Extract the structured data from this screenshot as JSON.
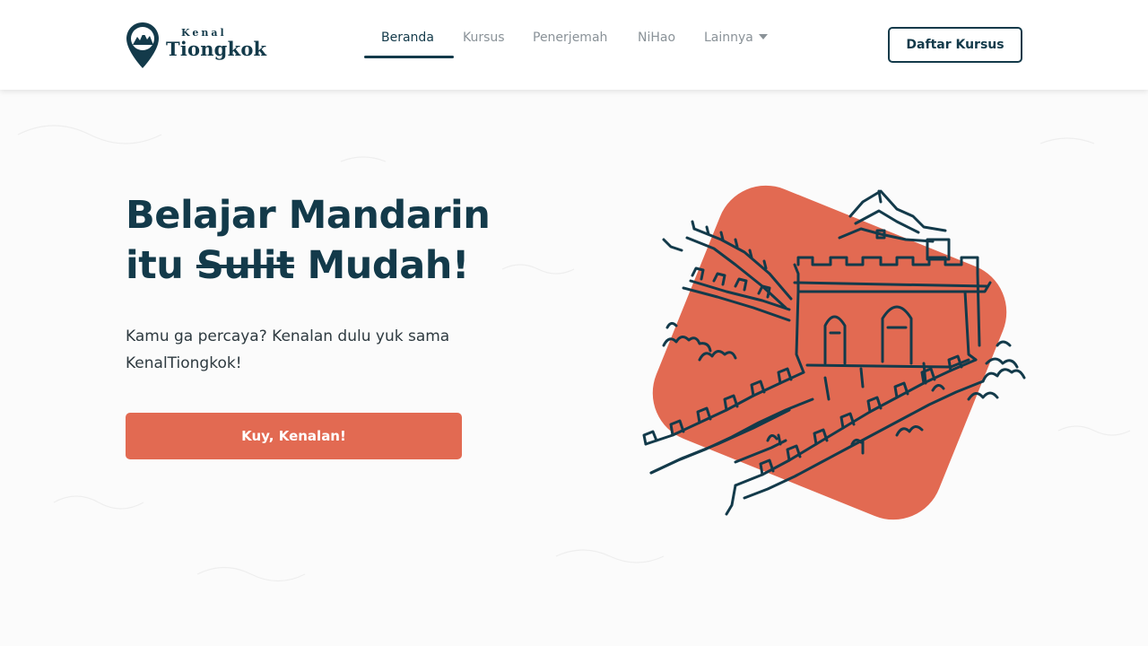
{
  "brand": {
    "small": "Kenal",
    "big": "Tiongkok",
    "colors": {
      "navy": "#133a4a",
      "coral": "#e26a52",
      "muted": "#8a9298"
    }
  },
  "nav": {
    "items": [
      {
        "label": "Beranda",
        "active": true
      },
      {
        "label": "Kursus",
        "active": false
      },
      {
        "label": "Penerjemah",
        "active": false
      },
      {
        "label": "NiHao",
        "active": false
      },
      {
        "label": "Lainnya",
        "active": false,
        "dropdown": true
      }
    ],
    "cta_label": "Daftar Kursus"
  },
  "hero": {
    "title_line1": "Belajar Mandarin",
    "title_itu": "itu",
    "title_struck": "Sulit",
    "title_end": "Mudah!",
    "subtitle": "Kamu ga percaya? Kenalan dulu yuk sama KenalTiongkok!",
    "cta_label": "Kuy, Kenalan!"
  },
  "icons": {
    "logo": "map-pin-mountain-icon",
    "dropdown": "caret-down-icon",
    "illustration": "great-wall-illustration"
  }
}
